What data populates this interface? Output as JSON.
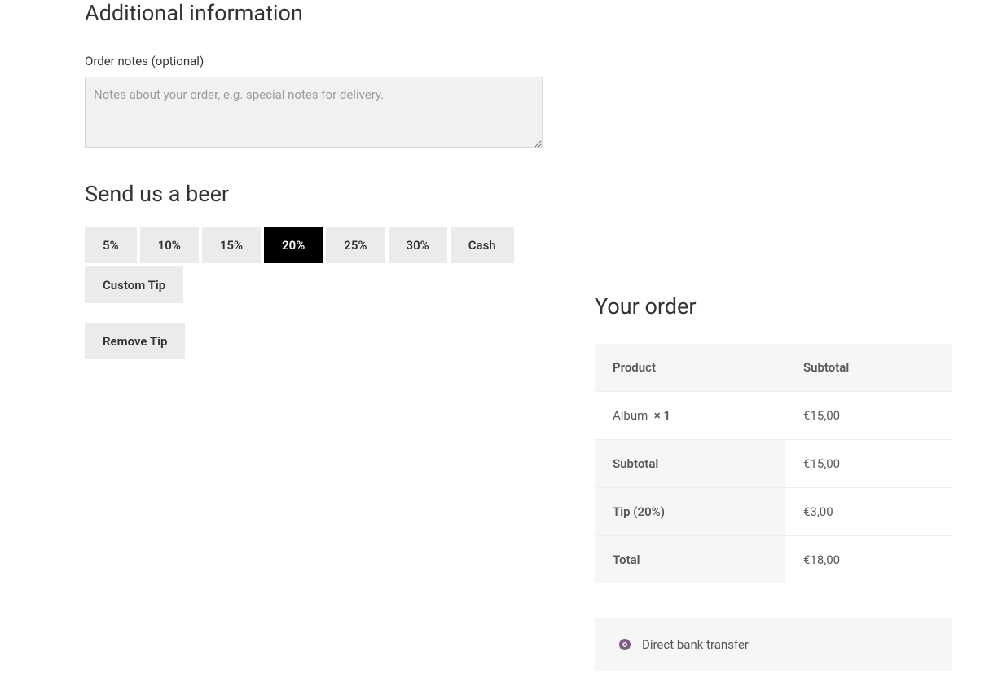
{
  "additional": {
    "heading": "Additional information",
    "notes_label": "Order notes (optional)",
    "notes_placeholder": "Notes about your order, e.g. special notes for delivery."
  },
  "tip": {
    "heading": "Send us a beer",
    "options": [
      "5%",
      "10%",
      "15%",
      "20%",
      "25%",
      "30%",
      "Cash",
      "Custom Tip"
    ],
    "active_index": 3,
    "remove_label": "Remove Tip"
  },
  "order": {
    "heading": "Your order",
    "col_product": "Product",
    "col_subtotal": "Subtotal",
    "item_name": "Album",
    "item_qty": "× 1",
    "item_subtotal": "€15,00",
    "subtotal_label": "Subtotal",
    "subtotal_value": "€15,00",
    "tip_label": "Tip (20%)",
    "tip_value": "€3,00",
    "total_label": "Total",
    "total_value": "€18,00"
  },
  "payment": {
    "method_label": "Direct bank transfer"
  }
}
